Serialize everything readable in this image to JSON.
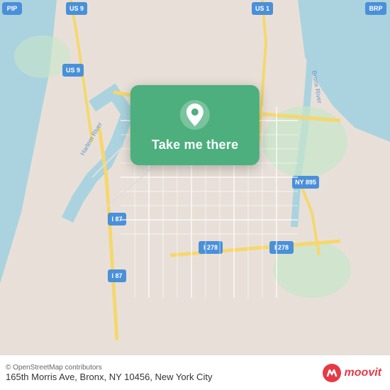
{
  "map": {
    "background_color": "#e8e0d8",
    "alt": "Map of Bronx, NY area"
  },
  "overlay": {
    "button_label": "Take me there",
    "background_color": "#4caf7d"
  },
  "footer": {
    "osm_credit": "© OpenStreetMap contributors",
    "address": "165th Morris Ave, Bronx, NY 10456, New York City",
    "moovit_label": "moovit"
  }
}
